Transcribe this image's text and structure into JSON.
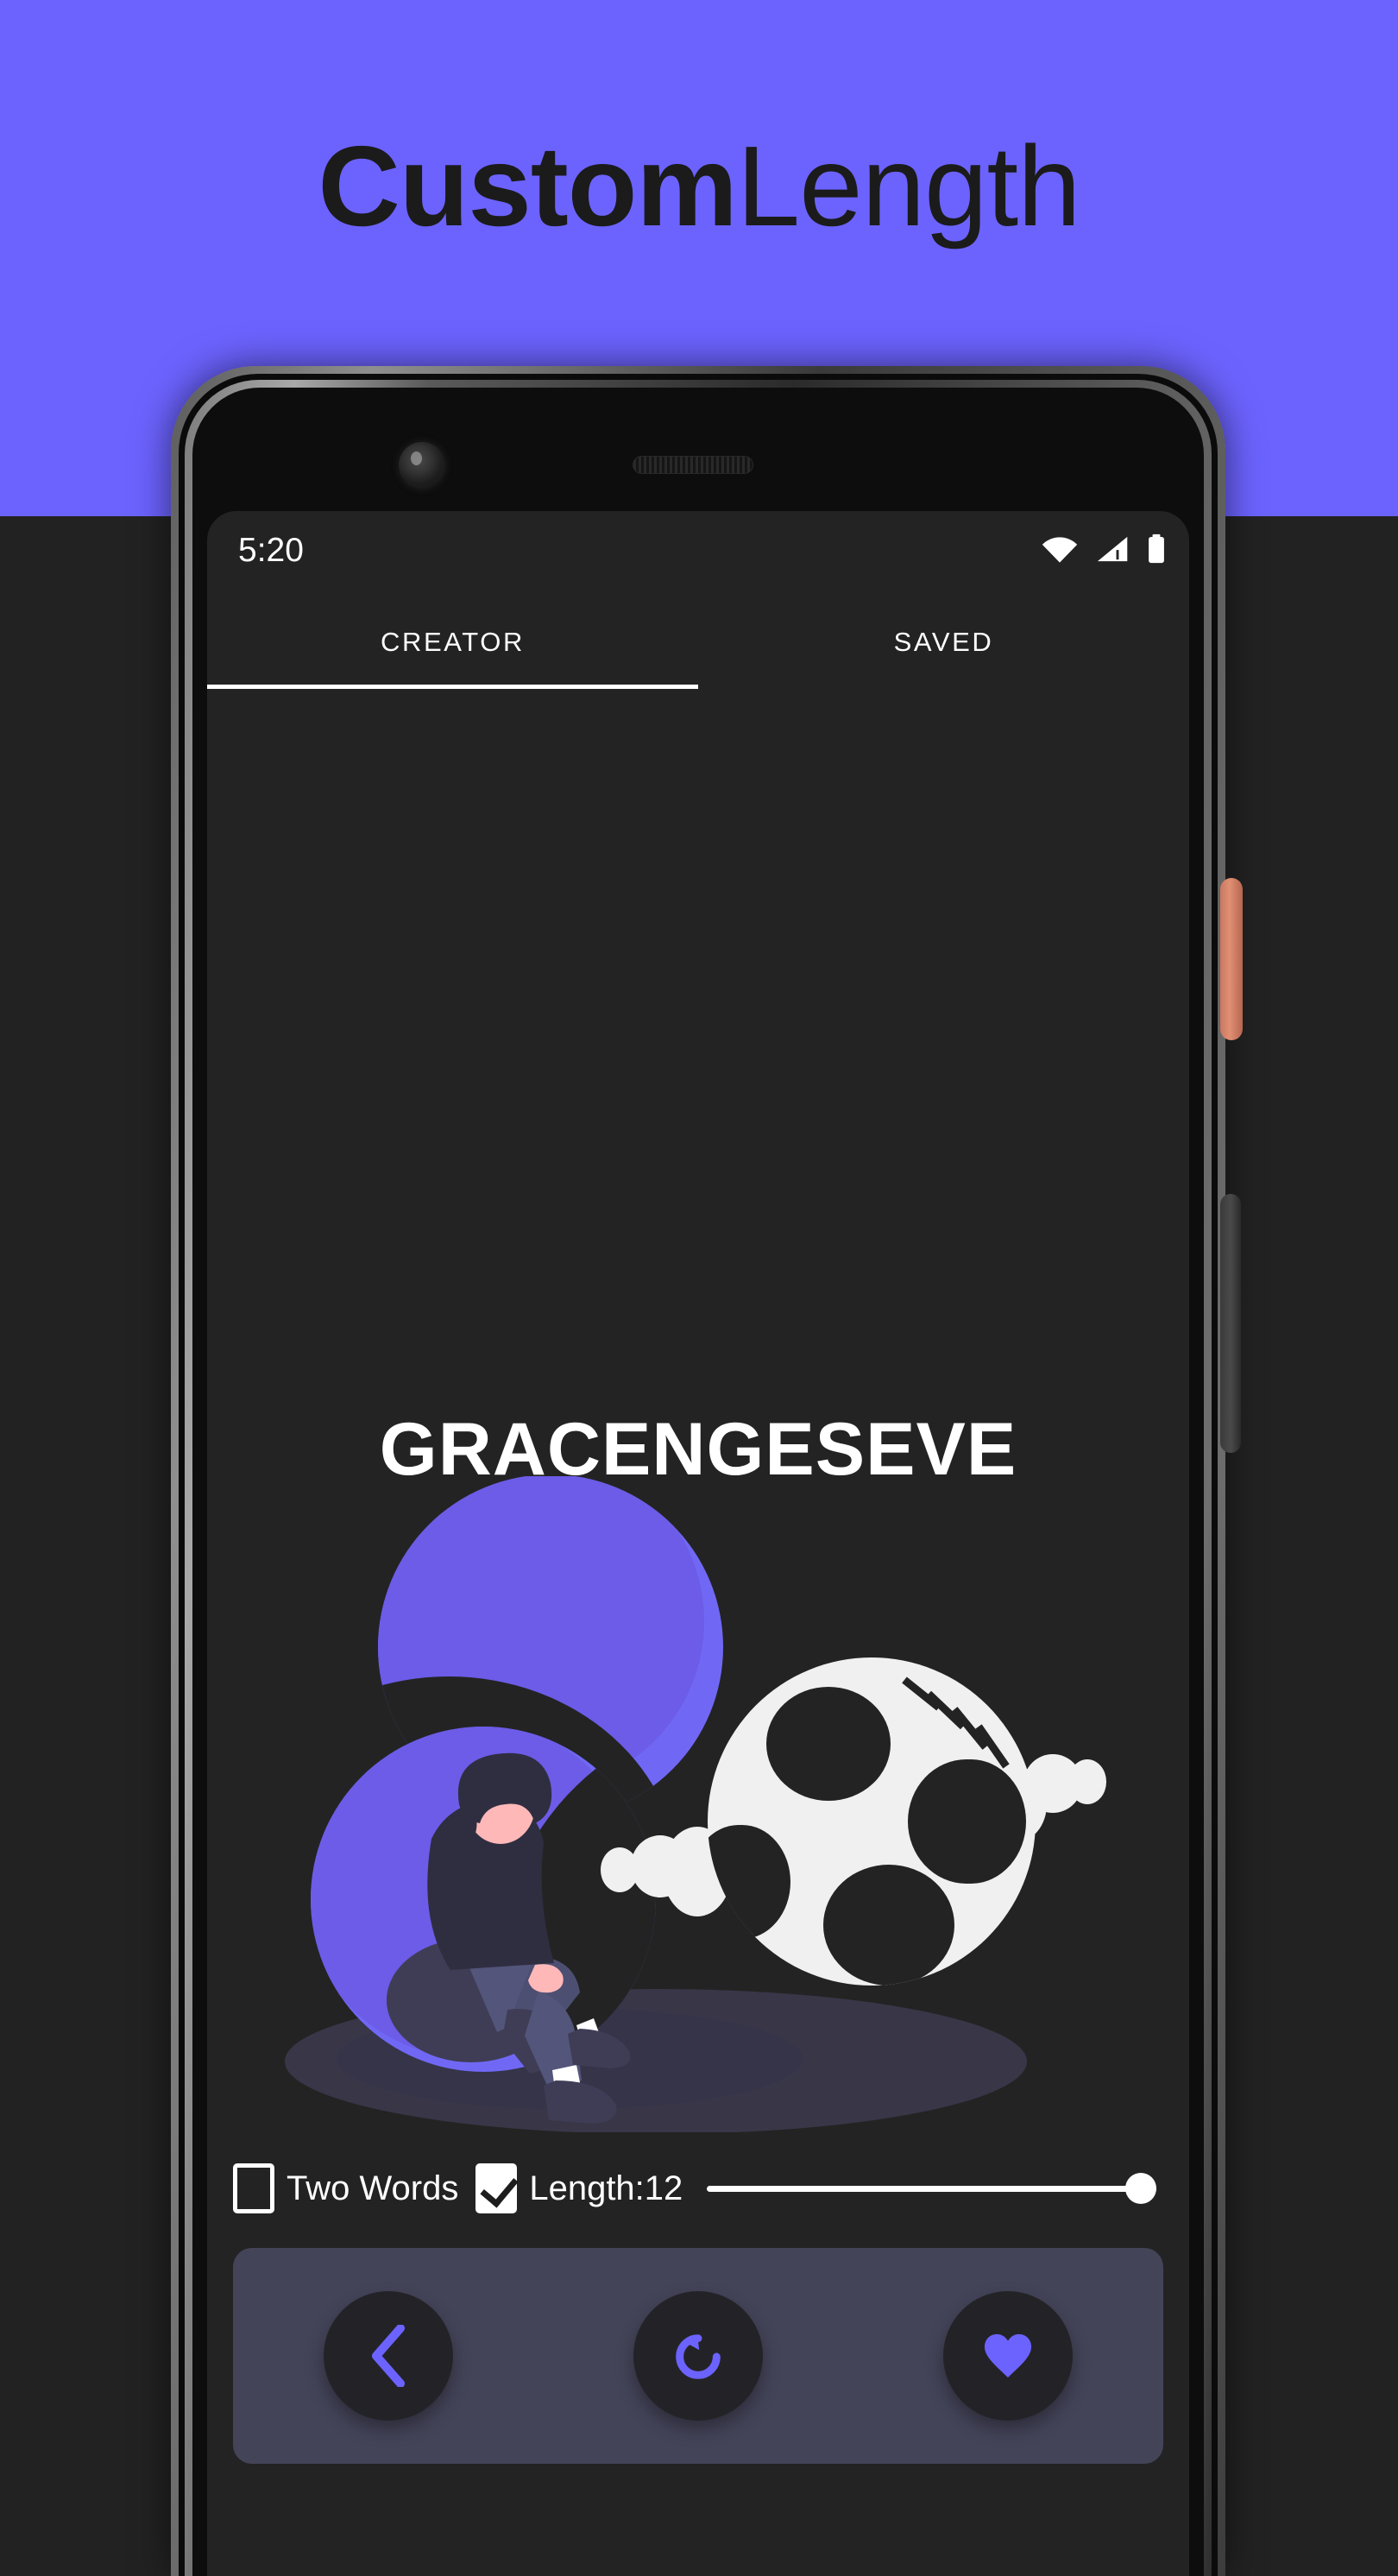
{
  "promo": {
    "title_bold": "Custom",
    "title_light": "Length",
    "banner_color": "#6C63FF"
  },
  "device": {
    "power_button_color": "#dd8a70",
    "volume_button_color": "#3f3f3f",
    "frame_color": "#6d6d6d",
    "hardware": {
      "front_camera": "front-camera",
      "earpiece": "earpiece-speaker"
    }
  },
  "status_bar": {
    "time": "5:20",
    "icons": [
      "wifi-icon",
      "cellular-signal-icon",
      "battery-icon"
    ]
  },
  "tabs": [
    {
      "label": "CREATOR",
      "active": true
    },
    {
      "label": "SAVED",
      "active": false
    }
  ],
  "main": {
    "generated_word": "GRACENGESEVE",
    "word_length": 12,
    "illustration": {
      "name": "person-sitting-under-moon-illustration",
      "accent_color": "#6C5CE7",
      "planet_color": "#f0f0f0",
      "ground_shadow_color": "#403e52",
      "skin_color": "#ffb8b8",
      "clothing_color": "#2f2e41"
    }
  },
  "options": {
    "two_words": {
      "label": "Two Words",
      "checked": false
    },
    "length": {
      "label": "Length:12",
      "checked": true
    },
    "slider": {
      "value": 100,
      "min": 0,
      "max": 100
    }
  },
  "action_bar": {
    "background": "#444459",
    "buttons": [
      {
        "name": "previous-button",
        "icon": "chevron-left-icon",
        "color": "#6C63FF"
      },
      {
        "name": "regenerate-button",
        "icon": "refresh-icon",
        "color": "#6C63FF"
      },
      {
        "name": "favorite-button",
        "icon": "heart-icon",
        "color": "#6C63FF"
      }
    ]
  }
}
